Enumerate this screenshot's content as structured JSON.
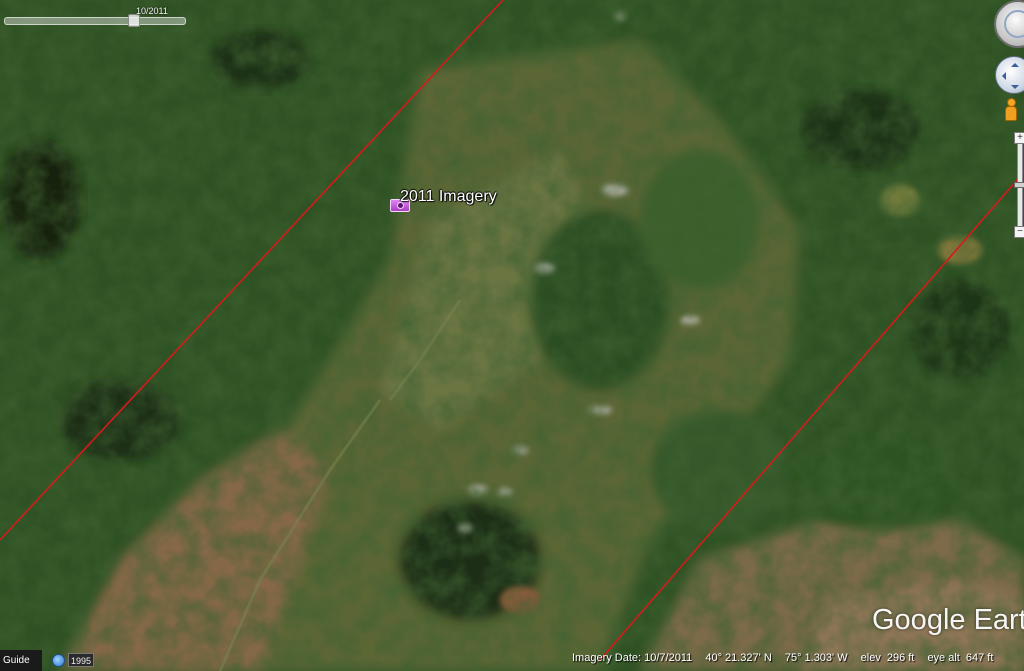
{
  "time_slider": {
    "date_label": "10/2011"
  },
  "placemark": {
    "label": "2011 Imagery",
    "icon": "camera-icon"
  },
  "watermark": "Google Earth",
  "bottom": {
    "guide_label": "Guide",
    "history_year": "1995",
    "history_icon": "clock-history-icon"
  },
  "status": {
    "imagery_date": "Imagery Date: 10/7/2011",
    "latitude": "40° 21.327' N",
    "longitude": "75° 1.303' W",
    "elev_label": "elev",
    "elev_value": "296 ft",
    "eye_alt_label": "eye alt",
    "eye_alt_value": "647 ft"
  },
  "colors": {
    "boundary_line": "#d61a1a",
    "forest_dark": "#1e3a16",
    "forest": "#3f6a2c",
    "meadow": "#5f6a38",
    "dry_grass": "#8a6a45"
  },
  "nav_controls": {
    "compass": "compass-icon",
    "look": "look-joystick-icon",
    "street_view": "pegman-icon",
    "zoom_in": "+",
    "zoom_out": "−"
  }
}
